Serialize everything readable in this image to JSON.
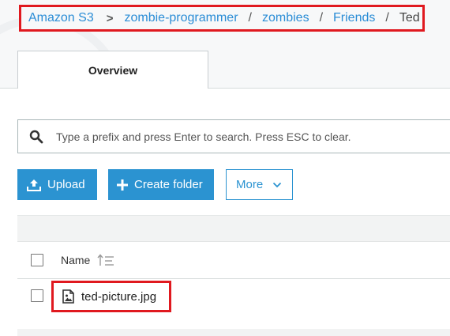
{
  "breadcrumb": {
    "items": [
      "Amazon S3",
      "zombie-programmer",
      "zombies",
      "Friends"
    ],
    "current": "Ted",
    "separators": [
      ">",
      "/",
      "/",
      "/"
    ]
  },
  "tabs": [
    {
      "label": "Overview",
      "active": true
    }
  ],
  "search": {
    "placeholder": "Type a prefix and press Enter to search. Press ESC to clear.",
    "value": ""
  },
  "toolbar": {
    "upload_label": "Upload",
    "create_folder_label": "Create folder",
    "more_label": "More"
  },
  "table": {
    "columns": [
      "Name"
    ],
    "rows": [
      {
        "name": "ted-picture.jpg",
        "type": "image"
      }
    ]
  },
  "icons": {
    "search": "search-icon",
    "upload": "upload-icon",
    "plus": "plus-icon",
    "more": "chevron-down-icon",
    "sort": "sort-ascending-icon",
    "file": "image-file-icon"
  },
  "colors": {
    "primary": "#2b93d1",
    "link": "#2b8dd6",
    "highlight": "#e0191f"
  }
}
